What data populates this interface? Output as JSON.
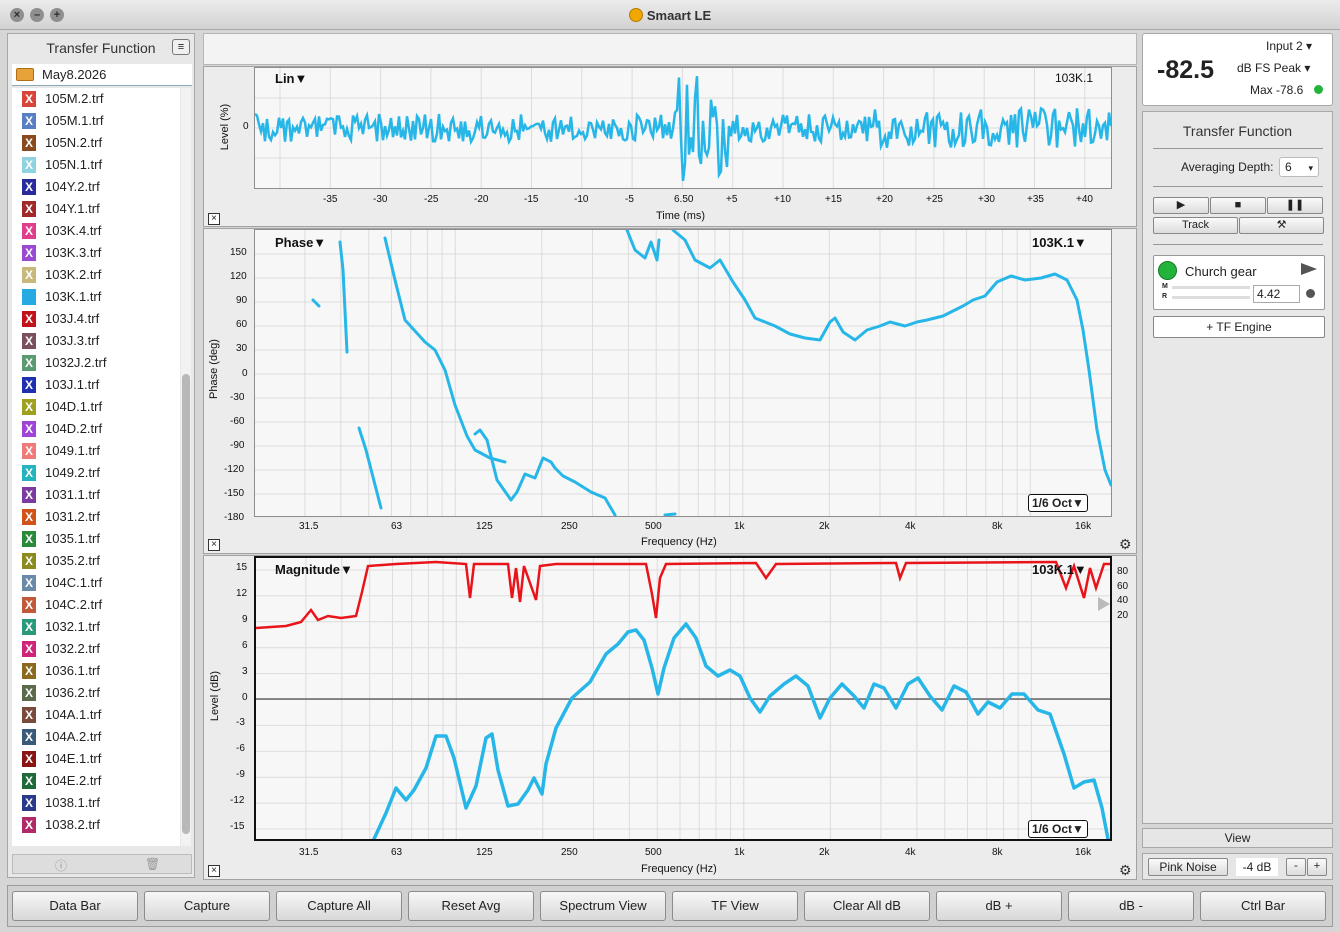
{
  "app": {
    "title": "Smaart LE",
    "window_buttons": [
      "close",
      "minimize",
      "zoom"
    ]
  },
  "left_panel": {
    "title": "Transfer Function",
    "folder": "May8.2026",
    "files": [
      {
        "name": "105M.2.trf",
        "color": "#d8453b",
        "icon": "x-icon"
      },
      {
        "name": "105M.1.trf",
        "color": "#5a7ec4",
        "icon": "x-icon"
      },
      {
        "name": "105N.2.trf",
        "color": "#8a4a1f",
        "icon": "x-icon"
      },
      {
        "name": "105N.1.trf",
        "color": "#8fd3e0",
        "icon": "x-icon"
      },
      {
        "name": "104Y.2.trf",
        "color": "#2a2a9e",
        "icon": "x-icon"
      },
      {
        "name": "104Y.1.trf",
        "color": "#a02a2a",
        "icon": "x-icon"
      },
      {
        "name": "103K.4.trf",
        "color": "#e03e8c",
        "icon": "x-icon"
      },
      {
        "name": "103K.3.trf",
        "color": "#9a4ad0",
        "icon": "x-icon"
      },
      {
        "name": "103K.2.trf",
        "color": "#c8b87a",
        "icon": "x-icon"
      },
      {
        "name": "103K.1.trf",
        "color": "#27a9e1",
        "icon": "file-icon"
      },
      {
        "name": "103J.4.trf",
        "color": "#c0141a",
        "icon": "x-icon"
      },
      {
        "name": "103J.3.trf",
        "color": "#7a5060",
        "icon": "x-icon"
      },
      {
        "name": "1032J.2.trf",
        "color": "#5a9a70",
        "icon": "x-icon"
      },
      {
        "name": "103J.1.trf",
        "color": "#1e2fb0",
        "icon": "x-icon"
      },
      {
        "name": "104D.1.trf",
        "color": "#a0a020",
        "icon": "x-icon"
      },
      {
        "name": "104D.2.trf",
        "color": "#a044d8",
        "icon": "x-icon"
      },
      {
        "name": "1049.1.trf",
        "color": "#f07a7a",
        "icon": "x-icon"
      },
      {
        "name": "1049.2.trf",
        "color": "#24b4c0",
        "icon": "x-icon"
      },
      {
        "name": "1031.1.trf",
        "color": "#7a3aa0",
        "icon": "x-icon"
      },
      {
        "name": "1031.2.trf",
        "color": "#d0541a",
        "icon": "x-icon"
      },
      {
        "name": "1035.1.trf",
        "color": "#2a8a3a",
        "icon": "x-icon"
      },
      {
        "name": "1035.2.trf",
        "color": "#8a8a1e",
        "icon": "x-icon"
      },
      {
        "name": "104C.1.trf",
        "color": "#6a8aa8",
        "icon": "x-icon"
      },
      {
        "name": "104C.2.trf",
        "color": "#c05a3a",
        "icon": "x-icon"
      },
      {
        "name": "1032.1.trf",
        "color": "#2a9a7a",
        "icon": "x-icon"
      },
      {
        "name": "1032.2.trf",
        "color": "#d0247a",
        "icon": "x-icon"
      },
      {
        "name": "1036.1.trf",
        "color": "#8a6a1e",
        "icon": "x-icon"
      },
      {
        "name": "1036.2.trf",
        "color": "#5a6a4a",
        "icon": "x-icon"
      },
      {
        "name": "104A.1.trf",
        "color": "#7a4a3a",
        "icon": "x-icon"
      },
      {
        "name": "104A.2.trf",
        "color": "#3a5a7a",
        "icon": "x-icon"
      },
      {
        "name": "104E.1.trf",
        "color": "#8a1414",
        "icon": "x-icon"
      },
      {
        "name": "104E.2.trf",
        "color": "#1e6a3a",
        "icon": "x-icon"
      },
      {
        "name": "1038.1.trf",
        "color": "#2a3a8a",
        "icon": "x-icon"
      },
      {
        "name": "1038.2.trf",
        "color": "#b02a6a",
        "icon": "x-icon"
      }
    ]
  },
  "impulse_plot": {
    "mode": "Lin▼",
    "trace": "103K.1",
    "y_title": "Level (%)",
    "y_ticks": [
      "0"
    ],
    "x_title": "Time (ms)",
    "x_ticks": [
      "-35",
      "-30",
      "-25",
      "-20",
      "-15",
      "-10",
      "-5",
      "6.50",
      "+5",
      "+10",
      "+15",
      "+20",
      "+25",
      "+30",
      "+35",
      "+40"
    ]
  },
  "phase_plot": {
    "mode": "Phase▼",
    "trace": "103K.1▼",
    "y_title": "Phase (deg)",
    "y_ticks": [
      "150",
      "120",
      "90",
      "60",
      "30",
      "0",
      "-30",
      "-60",
      "-90",
      "-120",
      "-150",
      "-180"
    ],
    "x_title": "Frequency (Hz)",
    "x_ticks": [
      "31.5",
      "63",
      "125",
      "250",
      "500",
      "1k",
      "2k",
      "4k",
      "8k",
      "16k"
    ],
    "smoothing": "1/6 Oct▼"
  },
  "magnitude_plot": {
    "mode": "Magnitude▼",
    "trace": "103K.1▼",
    "y_title": "Level (dB)",
    "y_ticks": [
      "15",
      "12",
      "9",
      "6",
      "3",
      "0",
      "-3",
      "-6",
      "-9",
      "-12",
      "-15"
    ],
    "coherence_ticks": [
      "80",
      "60",
      "40",
      "20"
    ],
    "x_title": "Frequency (Hz)",
    "x_ticks": [
      "31.5",
      "63",
      "125",
      "250",
      "500",
      "1k",
      "2k",
      "4k",
      "8k",
      "16k"
    ],
    "smoothing": "1/6 Oct▼"
  },
  "meter": {
    "value": "-82.5",
    "input": "Input 2",
    "unit": "dB FS Peak",
    "max": "Max -78.6",
    "status_color": "#22b43a"
  },
  "right_panel": {
    "title": "Transfer Function",
    "averaging_label": "Averaging Depth:",
    "averaging_value": "6",
    "track_label": "Track",
    "engine_name": "Church gear",
    "engine_m": "M",
    "engine_r": "R",
    "engine_delay": "4.42",
    "tf_engine_label": "+ TF Engine",
    "view_label": "View",
    "pink_noise_label": "Pink Noise",
    "pink_level": "-4 dB",
    "minus_label": "-",
    "plus_label": "+"
  },
  "bottom_bar": [
    "Data Bar",
    "Capture",
    "Capture All",
    "Reset Avg",
    "Spectrum View",
    "TF View",
    "Clear All dB",
    "dB +",
    "dB -",
    "Ctrl Bar"
  ],
  "colors": {
    "trace": "#27b6e8",
    "coherence": "#e8141a",
    "grid": "#dcdcdc"
  }
}
